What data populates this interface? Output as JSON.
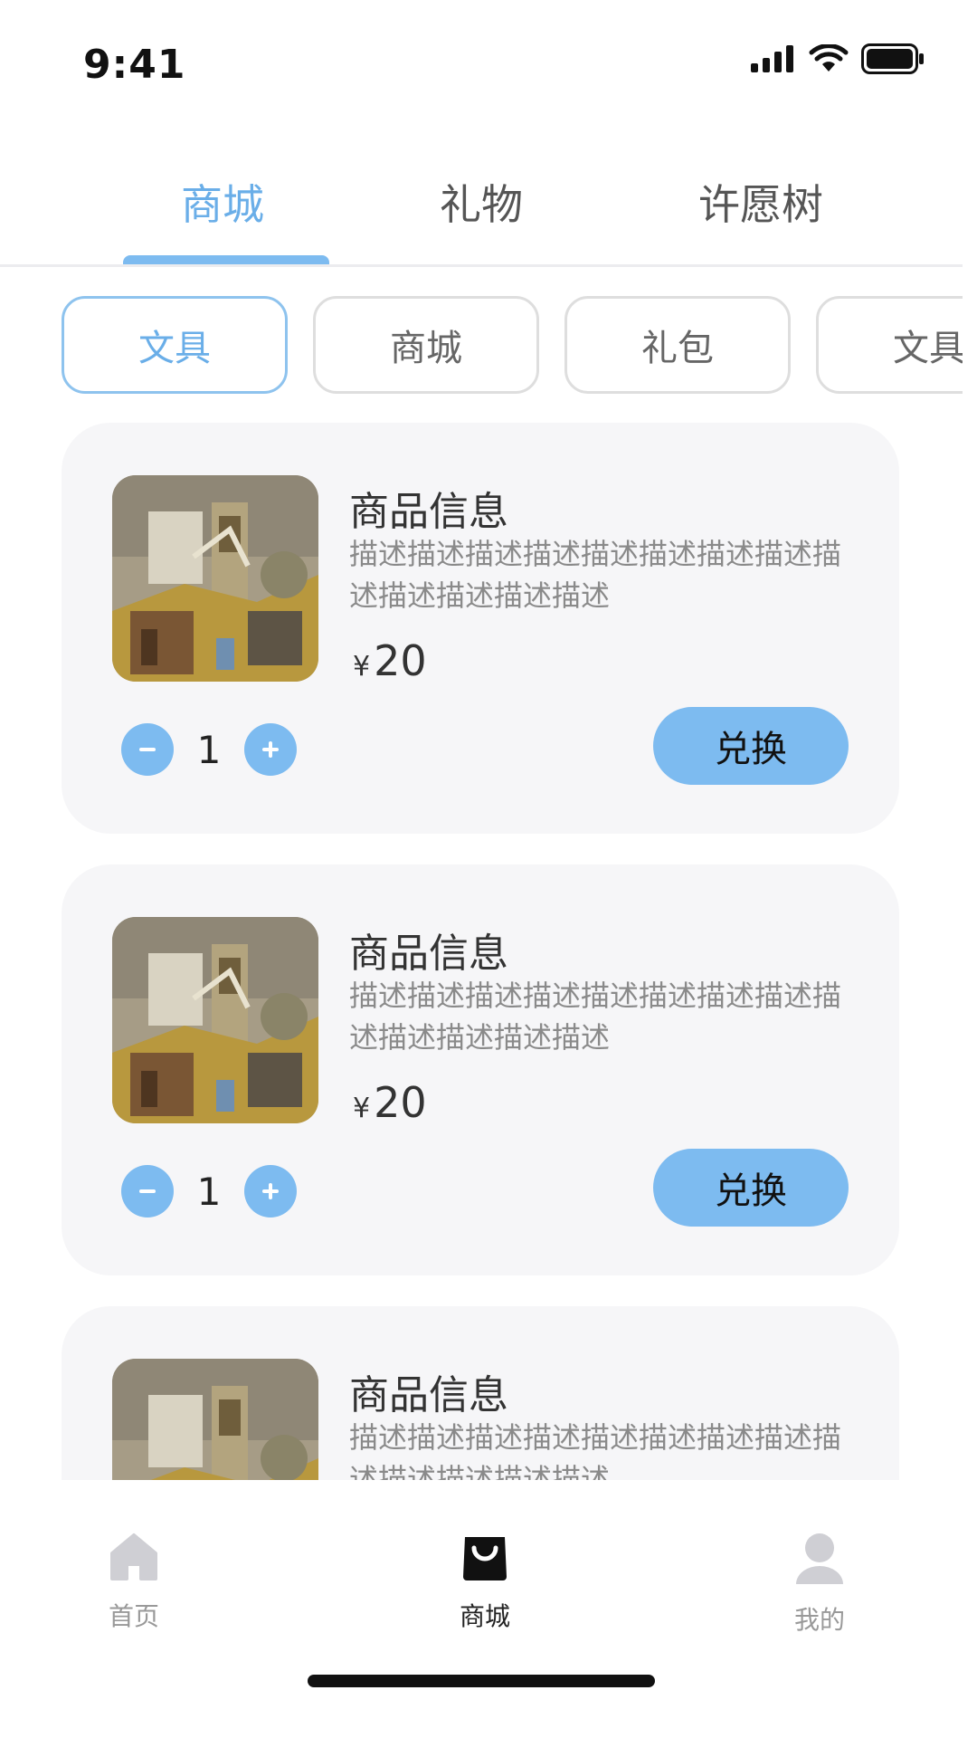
{
  "status": {
    "time": "9:41"
  },
  "top_tabs": [
    {
      "label": "商城",
      "active": true
    },
    {
      "label": "礼物",
      "active": false
    },
    {
      "label": "许愿树",
      "active": false
    }
  ],
  "chips": [
    {
      "label": "文具",
      "active": true
    },
    {
      "label": "商城",
      "active": false
    },
    {
      "label": "礼包",
      "active": false
    },
    {
      "label": "文具",
      "active": false
    }
  ],
  "products": [
    {
      "title": "商品信息",
      "description": "描述描述描述描述描述描述描述描述描述描述描述描述描述",
      "currency": "¥",
      "price": "20",
      "quantity": "1",
      "action": "兑换"
    },
    {
      "title": "商品信息",
      "description": "描述描述描述描述描述描述描述描述描述描述描述描述描述",
      "currency": "¥",
      "price": "20",
      "quantity": "1",
      "action": "兑换"
    },
    {
      "title": "商品信息",
      "description": "描述描述描述描述描述描述描述描述描述描述描述描述描述"
    }
  ],
  "bottom_nav": [
    {
      "label": "首页",
      "icon": "home-icon",
      "active": false
    },
    {
      "label": "商城",
      "icon": "shopping-bag-icon",
      "active": true
    },
    {
      "label": "我的",
      "icon": "user-icon",
      "active": false
    }
  ],
  "colors": {
    "accent": "#7dbbf0",
    "card_bg": "#f6f6f8",
    "nav_inactive": "#999999"
  }
}
